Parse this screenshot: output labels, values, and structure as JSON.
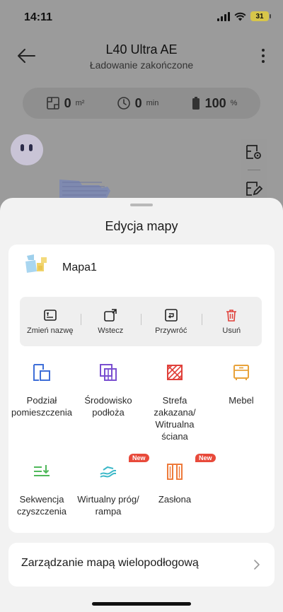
{
  "status_bar": {
    "time": "14:11",
    "battery": "31"
  },
  "header": {
    "title": "L40 Ultra AE",
    "subtitle": "Ładowanie zakończone"
  },
  "stats": [
    {
      "icon": "area-icon",
      "value": "0",
      "unit": "m²"
    },
    {
      "icon": "clock-icon",
      "value": "0",
      "unit": "min"
    },
    {
      "icon": "battery-icon",
      "value": "100",
      "unit": "%"
    }
  ],
  "sheet": {
    "title": "Edycja mapy",
    "map_name": "Mapa1",
    "actions": [
      {
        "label": "Zmień nazwę",
        "icon": "rename-icon"
      },
      {
        "label": "Wstecz",
        "icon": "undo-icon"
      },
      {
        "label": "Przywróć",
        "icon": "redo-icon"
      },
      {
        "label": "Usuń",
        "icon": "trash-icon"
      }
    ],
    "tools": [
      {
        "label": "Podział pomieszczenia",
        "icon": "room-divide-icon",
        "color": "#3f6fd8"
      },
      {
        "label": "Środowisko podłoża",
        "icon": "floor-material-icon",
        "color": "#7a4fd0"
      },
      {
        "label": "Strefa zakazana/ Witrualna ściana",
        "icon": "no-go-zone-icon",
        "color": "#e0403a"
      },
      {
        "label": "Mebel",
        "icon": "furniture-icon",
        "color": "#e8a23a"
      },
      {
        "label": "Sekwencja czyszczenia",
        "icon": "sequence-icon",
        "color": "#4fb85a"
      },
      {
        "label": "Wirtualny próg/ rampa",
        "icon": "threshold-icon",
        "color": "#3cb8c8",
        "badge": "New"
      },
      {
        "label": "Zasłona",
        "icon": "curtain-icon",
        "color": "#ee7a3a",
        "badge": "New"
      }
    ],
    "multi_floor": "Zarządzanie mapą wielopodłogową"
  }
}
